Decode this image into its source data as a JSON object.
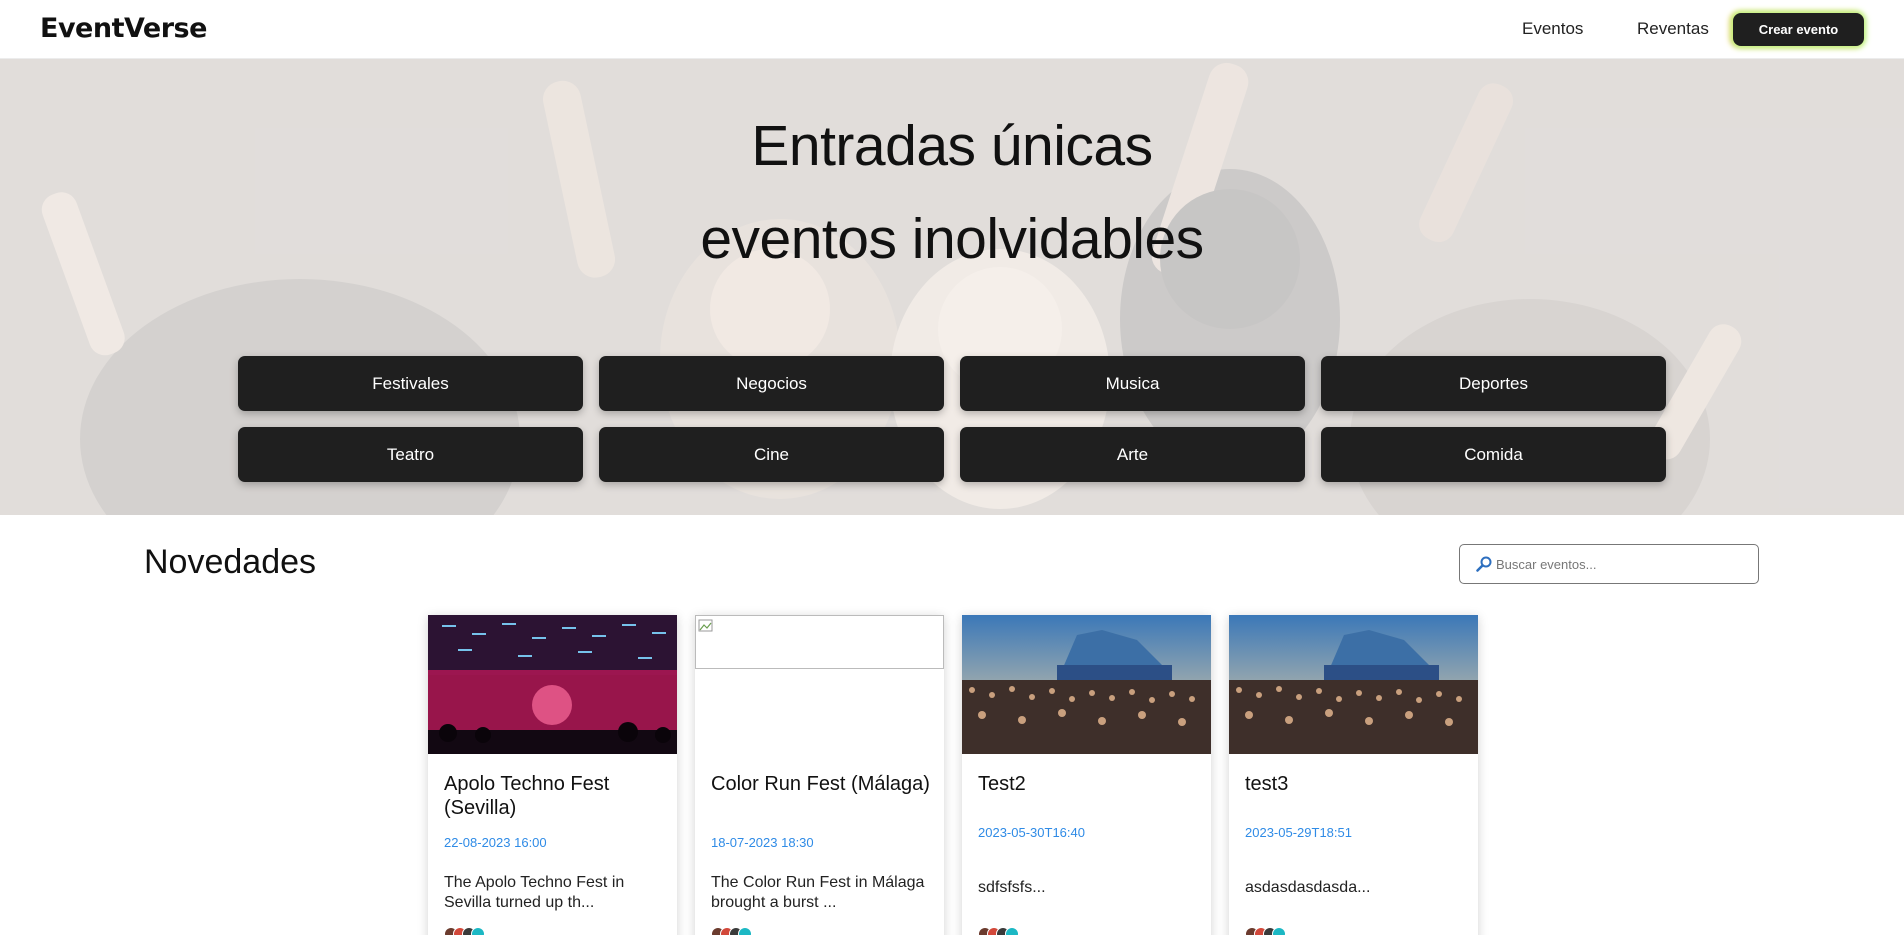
{
  "navbar": {
    "brand": "EventVerse",
    "links": [
      "Eventos",
      "Reventas"
    ],
    "create_button": "Crear evento"
  },
  "hero": {
    "title_line1": "Entradas únicas",
    "title_line2": "eventos inolvidables",
    "categories": [
      "Festivales",
      "Negocios",
      "Musica",
      "Deportes",
      "Teatro",
      "Cine",
      "Arte",
      "Comida"
    ]
  },
  "section": {
    "title": "Novedades",
    "search_placeholder": "Buscar eventos..."
  },
  "events": [
    {
      "title": "Apolo Techno Fest (Sevilla)",
      "date": "22-08-2023 16:00",
      "description": "The Apolo Techno Fest in Sevilla turned up th...",
      "image": "techno-club"
    },
    {
      "title": "Color Run Fest (Málaga)",
      "date": "18-07-2023 18:30",
      "description": "The Color Run Fest in Málaga brought a burst ...",
      "image": "broken"
    },
    {
      "title": "Test2",
      "date": "2023-05-30T16:40",
      "description": "sdfsfsfs...",
      "image": "festival-crowd"
    },
    {
      "title": "test3",
      "date": "2023-05-29T18:51",
      "description": "asdasdasdasda...",
      "image": "festival-crowd"
    }
  ],
  "colors": {
    "button_dark": "#1f1f1f",
    "date_blue": "#2f8be6",
    "glow_green": "#b7f77f",
    "glow_orange": "#f8c76a"
  }
}
